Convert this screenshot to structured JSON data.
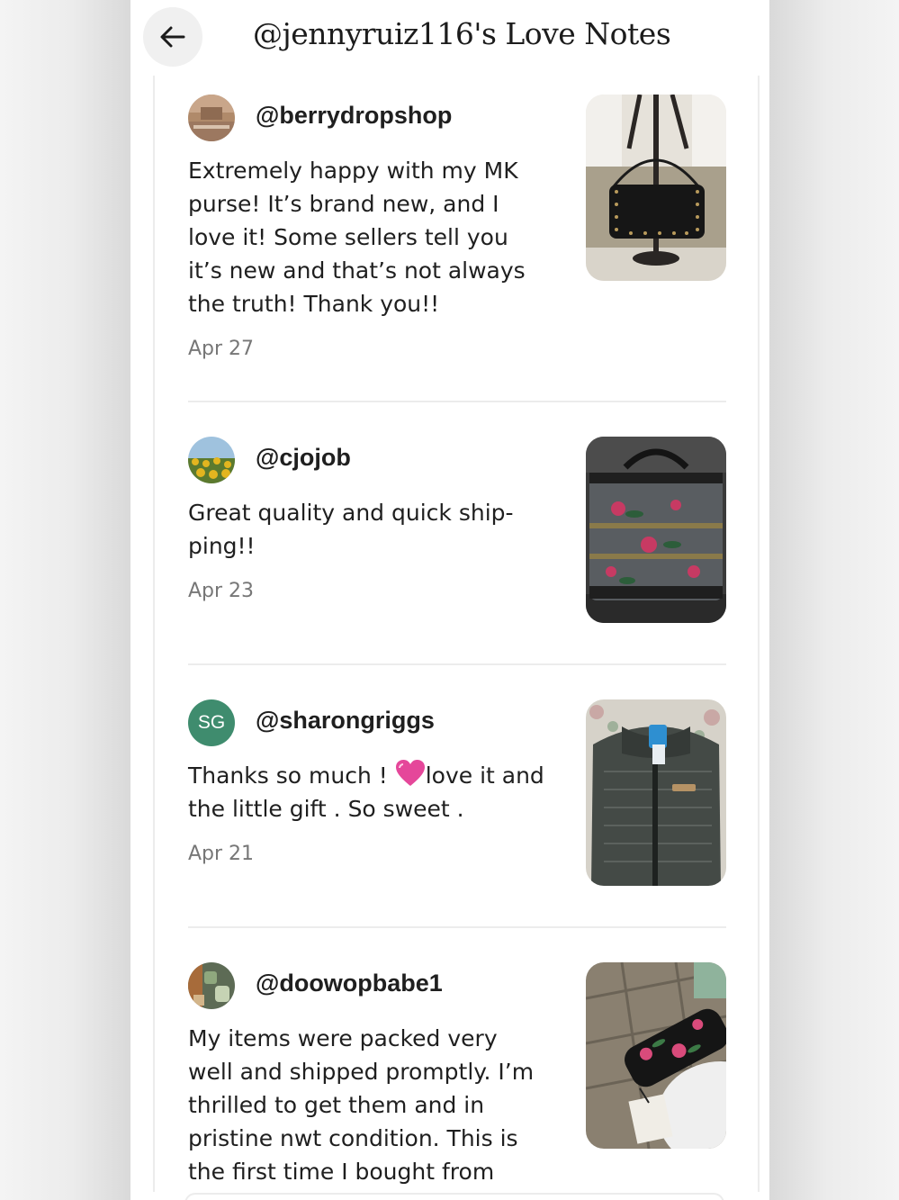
{
  "header": {
    "title": "@jennyruiz116's Love Notes"
  },
  "notes": [
    {
      "username": "@berrydropshop",
      "text": "Extremely happy with my MK purse! It’s brand new, and I love it! Some sellers tell you it’s new and that’s not always the truth! Thank you!!",
      "date": "Apr 27"
    },
    {
      "username": "@cjojob",
      "text": "Great quality and quick ship-ping!!",
      "date": "Apr 23"
    },
    {
      "username": "@sharongriggs",
      "avatar_initials": "SG",
      "text_before": "Thanks so much ! ",
      "text_after": "love it and the little gift . So sweet .",
      "date": "Apr 21"
    },
    {
      "username": "@doowopbabe1",
      "text": "My items were packed very well and shipped promptly. I’m thrilled to get them and in pristine nwt condition. This is the first time I bought from"
    }
  ],
  "colors": {
    "avatar_sg": "#3f8c6e",
    "divider": "#ececec",
    "date_text": "#777777"
  }
}
